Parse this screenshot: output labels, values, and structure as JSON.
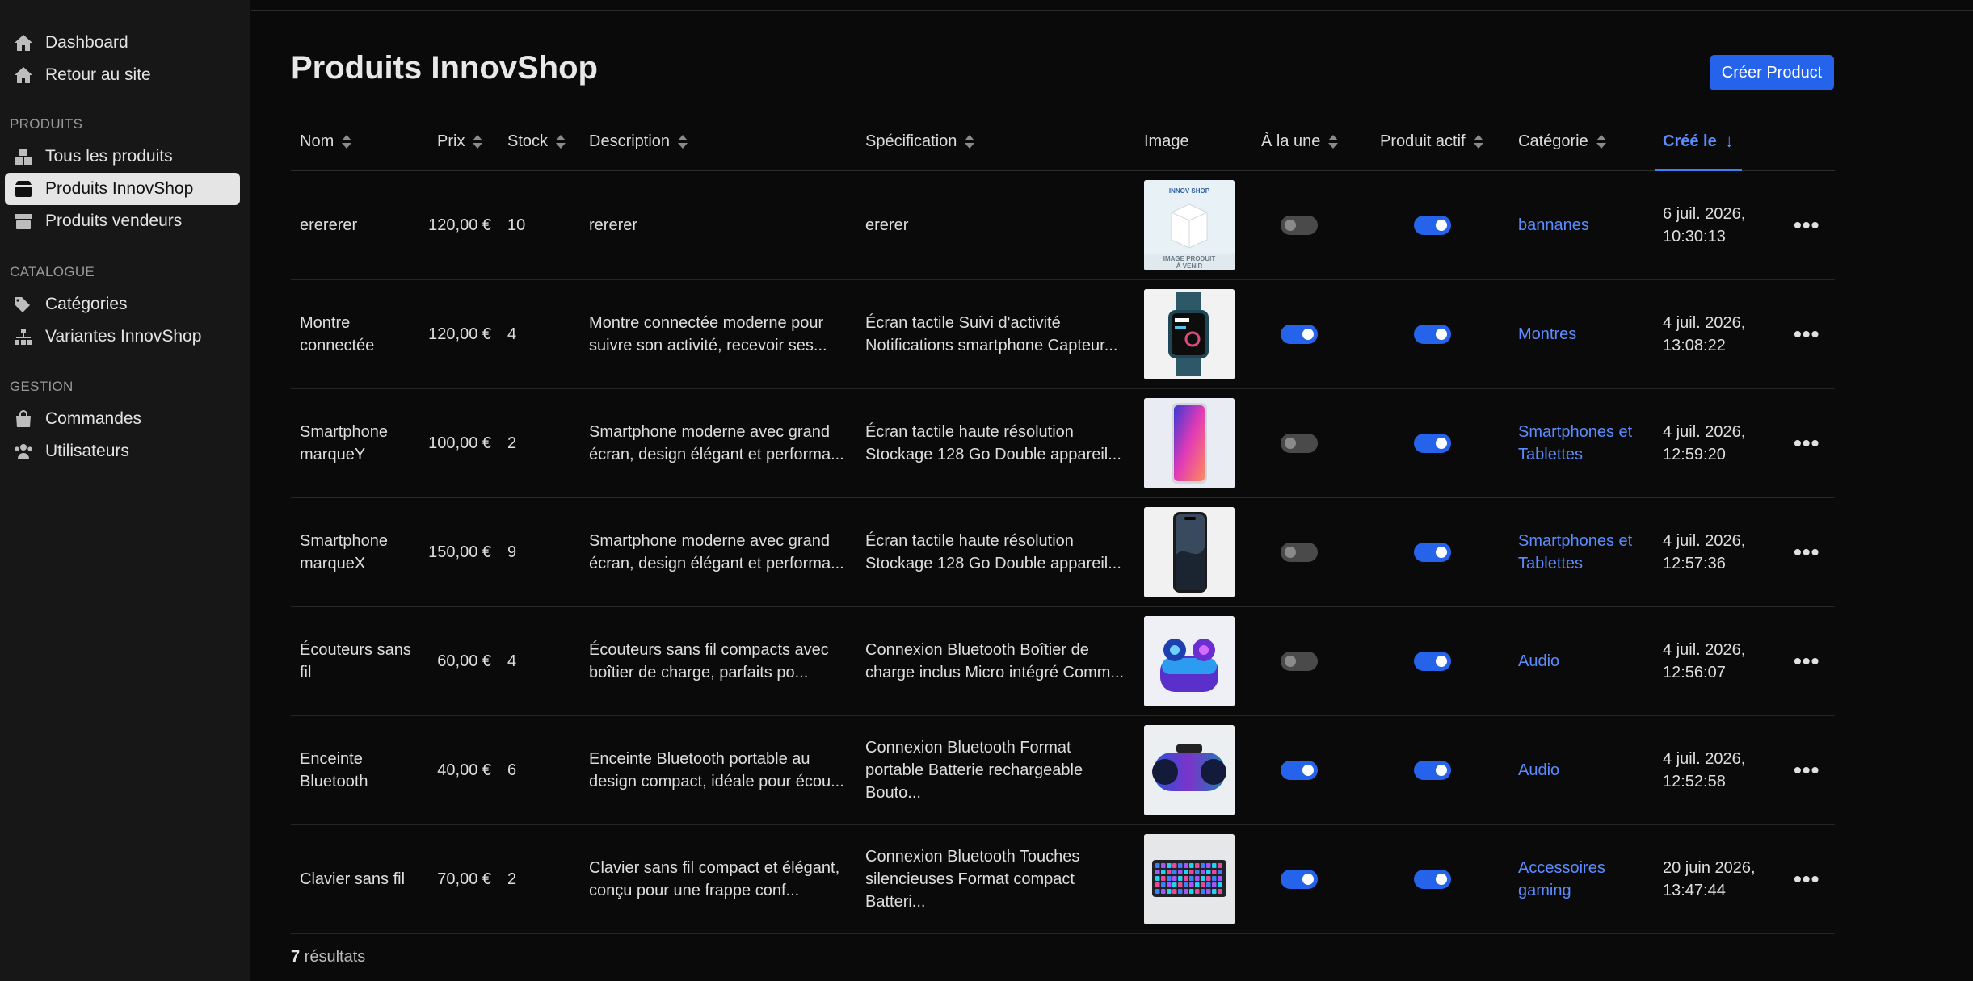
{
  "sidebar": {
    "items_top": [
      {
        "label": "Dashboard",
        "icon": "home-icon"
      },
      {
        "label": "Retour au site",
        "icon": "home-icon"
      }
    ],
    "sections": [
      {
        "label": "PRODUITS",
        "items": [
          {
            "label": "Tous les produits",
            "icon": "boxes-icon"
          },
          {
            "label": "Produits InnovShop",
            "icon": "box-icon",
            "active": true
          },
          {
            "label": "Produits vendeurs",
            "icon": "store-icon"
          }
        ]
      },
      {
        "label": "CATALOGUE",
        "items": [
          {
            "label": "Catégories",
            "icon": "tags-icon"
          },
          {
            "label": "Variantes InnovShop",
            "icon": "sitemap-icon"
          }
        ]
      },
      {
        "label": "GESTION",
        "items": [
          {
            "label": "Commandes",
            "icon": "bag-icon"
          },
          {
            "label": "Utilisateurs",
            "icon": "users-icon"
          }
        ]
      }
    ]
  },
  "page": {
    "title": "Produits InnovShop",
    "create_label": "Créer Product"
  },
  "table": {
    "columns": {
      "nom": "Nom",
      "prix": "Prix",
      "stock": "Stock",
      "description": "Description",
      "specification": "Spécification",
      "image": "Image",
      "a_la_une": "À la une",
      "actif": "Produit actif",
      "categorie": "Catégorie",
      "cree_le": "Créé le"
    },
    "rows": [
      {
        "nom": [
          "erererer"
        ],
        "prix": "120,00 €",
        "stock": "10",
        "description": [
          "rererer"
        ],
        "specification": [
          "ererer"
        ],
        "image": "placeholder",
        "a_la_une": false,
        "actif": true,
        "categorie": [
          "bannanes"
        ],
        "date": "6 juil. 2026,",
        "time": "10:30:13"
      },
      {
        "nom": [
          "Montre",
          "connectée"
        ],
        "prix": "120,00 €",
        "stock": "4",
        "description": [
          "Montre connectée moderne pour",
          "suivre son activité, recevoir ses..."
        ],
        "specification": [
          "Écran tactile Suivi d'activité",
          "Notifications smartphone Capteur..."
        ],
        "image": "watch",
        "a_la_une": true,
        "actif": true,
        "categorie": [
          "Montres"
        ],
        "date": "4 juil. 2026,",
        "time": "13:08:22"
      },
      {
        "nom": [
          "Smartphone",
          "marqueY"
        ],
        "prix": "100,00 €",
        "stock": "2",
        "description": [
          "Smartphone moderne avec grand",
          "écran, design élégant et performa..."
        ],
        "specification": [
          "Écran tactile haute résolution",
          "Stockage 128 Go Double appareil..."
        ],
        "image": "phone-y",
        "a_la_une": false,
        "actif": true,
        "categorie": [
          "Smartphones et",
          "Tablettes"
        ],
        "date": "4 juil. 2026,",
        "time": "12:59:20"
      },
      {
        "nom": [
          "Smartphone",
          "marqueX"
        ],
        "prix": "150,00 €",
        "stock": "9",
        "description": [
          "Smartphone moderne avec grand",
          "écran, design élégant et performa..."
        ],
        "specification": [
          "Écran tactile haute résolution",
          "Stockage 128 Go Double appareil..."
        ],
        "image": "phone-x",
        "a_la_une": false,
        "actif": true,
        "categorie": [
          "Smartphones et",
          "Tablettes"
        ],
        "date": "4 juil. 2026,",
        "time": "12:57:36"
      },
      {
        "nom": [
          "Écouteurs sans",
          "fil"
        ],
        "prix": "60,00 €",
        "stock": "4",
        "description": [
          "Écouteurs sans fil compacts avec",
          "boîtier de charge, parfaits po..."
        ],
        "specification": [
          "Connexion Bluetooth Boîtier de",
          "charge inclus Micro intégré Comm..."
        ],
        "image": "earbuds",
        "a_la_une": false,
        "actif": true,
        "categorie": [
          "Audio"
        ],
        "date": "4 juil. 2026,",
        "time": "12:56:07"
      },
      {
        "nom": [
          "Enceinte",
          "Bluetooth"
        ],
        "prix": "40,00 €",
        "stock": "6",
        "description": [
          "Enceinte Bluetooth portable au",
          "design compact, idéale pour écou..."
        ],
        "specification": [
          "Connexion Bluetooth Format",
          "portable Batterie rechargeable",
          "Bouto..."
        ],
        "image": "speaker",
        "a_la_une": true,
        "actif": true,
        "categorie": [
          "Audio"
        ],
        "date": "4 juil. 2026,",
        "time": "12:52:58"
      },
      {
        "nom": [
          "Clavier sans fil"
        ],
        "prix": "70,00 €",
        "stock": "2",
        "description": [
          "Clavier sans fil compact et élégant,",
          "conçu pour une frappe conf..."
        ],
        "specification": [
          "Connexion Bluetooth Touches",
          "silencieuses Format compact",
          "Batteri..."
        ],
        "image": "keyboard",
        "a_la_une": true,
        "actif": true,
        "categorie": [
          "Accessoires",
          "gaming"
        ],
        "date": "20 juin 2026,",
        "time": "13:47:44"
      }
    ]
  },
  "footer": {
    "count": "7",
    "label": " résultats"
  },
  "colors": {
    "accent": "#2563eb",
    "link": "#5b8cff",
    "background": "#0a0a0a",
    "sidebar": "#171717"
  },
  "placeholder_image_text": {
    "brand": "INNOV SHOP",
    "line1": "IMAGE PRODUIT",
    "line2": "À VENIR"
  }
}
